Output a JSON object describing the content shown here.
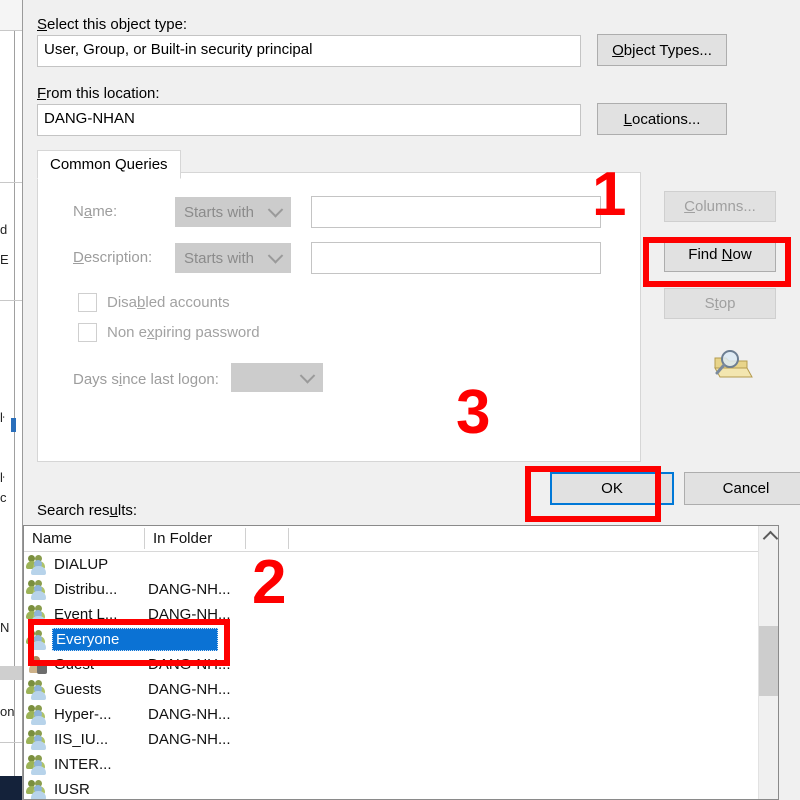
{
  "dialog": {
    "object_type_label": "Select this object type:",
    "object_type_accel": "S",
    "object_type_value": "User, Group, or Built-in security principal",
    "object_types_button": "Object Types...",
    "object_types_accel": "O",
    "location_label": "From this location:",
    "location_accel": "F",
    "location_value": "DANG-NHAN",
    "locations_button": "Locations...",
    "locations_accel": "L"
  },
  "tabs": [
    {
      "label": "Common Queries",
      "selected": true
    }
  ],
  "query": {
    "name_label": "Name:",
    "name_accel": "a",
    "name_operator": "Starts with",
    "name_value": "",
    "description_label": "Description:",
    "description_accel": "D",
    "description_operator": "Starts with",
    "description_value": "",
    "disabled_accounts_label": "Disabled accounts",
    "disabled_accounts_accel": "b",
    "disabled_accounts_checked": false,
    "non_expiring_label": "Non expiring password",
    "non_expiring_accel": "x",
    "non_expiring_checked": false,
    "days_label": "Days since last logon:",
    "days_accel": "i",
    "days_value": ""
  },
  "side_buttons": {
    "columns": "Columns...",
    "columns_accel": "C",
    "columns_enabled": false,
    "find_now": "Find Now",
    "find_now_accel": "N",
    "find_now_enabled": true,
    "stop": "Stop",
    "stop_accel": "t",
    "stop_enabled": false,
    "search_icon_name": "magnifier-folder-icon"
  },
  "footer": {
    "ok": "OK",
    "cancel": "Cancel"
  },
  "results": {
    "label": "Search results:",
    "label_accel": "u",
    "columns": [
      "Name",
      "In Folder"
    ],
    "rows": [
      {
        "name": "DIALUP",
        "folder": "",
        "icon": "group-icon",
        "selected": false
      },
      {
        "name": "Distribu...",
        "folder": "DANG-NH...",
        "icon": "group-icon",
        "selected": false
      },
      {
        "name": "Event L...",
        "folder": "DANG-NH...",
        "icon": "group-icon",
        "selected": false
      },
      {
        "name": "Everyone",
        "folder": "",
        "icon": "group-icon",
        "selected": true
      },
      {
        "name": "Guest",
        "folder": "DANG-NH...",
        "icon": "user-icon",
        "selected": false
      },
      {
        "name": "Guests",
        "folder": "DANG-NH...",
        "icon": "group-icon",
        "selected": false
      },
      {
        "name": "Hyper-...",
        "folder": "DANG-NH...",
        "icon": "group-icon",
        "selected": false
      },
      {
        "name": "IIS_IU...",
        "folder": "DANG-NH...",
        "icon": "group-icon",
        "selected": false
      },
      {
        "name": "INTER...",
        "folder": "",
        "icon": "group-icon",
        "selected": false
      },
      {
        "name": "IUSR",
        "folder": "",
        "icon": "group-icon",
        "selected": false
      }
    ]
  },
  "annotations": {
    "step1": "1",
    "step2": "2",
    "step3": "3",
    "color": "#FE0000",
    "highlight_find_now": true,
    "highlight_everyone": true,
    "highlight_ok": true
  },
  "colors": {
    "dialog_bg": "#F0F0F0",
    "field_bg": "#FFFFFF",
    "button_bg": "#E1E1E1",
    "selection_blue": "#0B72D4",
    "focus_blue": "#0078D7",
    "disabled_text": "#9D9D9D",
    "annotation_red": "#FE0000"
  }
}
